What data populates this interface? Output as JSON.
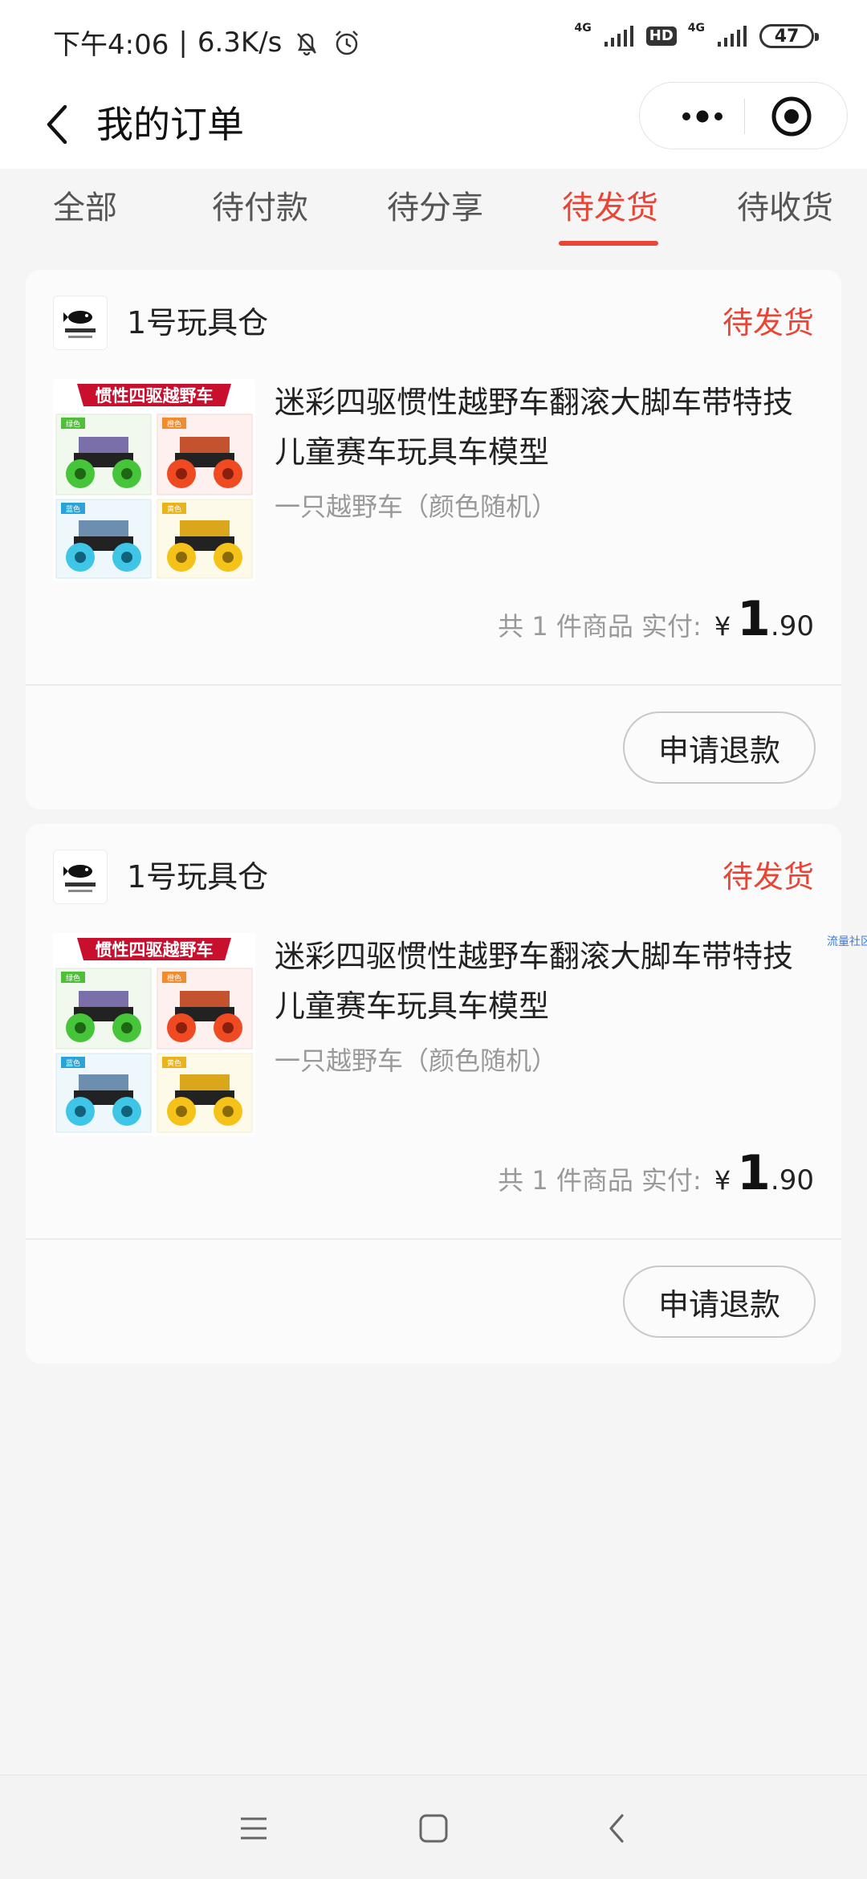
{
  "status_bar": {
    "time": "下午4:06",
    "speed": "6.3K/s",
    "network_1": "4G",
    "hd": "HD",
    "network_2": "4G",
    "battery": "47"
  },
  "nav": {
    "title": "我的订单"
  },
  "tabs": [
    {
      "label": "全部"
    },
    {
      "label": "待付款"
    },
    {
      "label": "待分享"
    },
    {
      "label": "待发货",
      "active": true
    },
    {
      "label": "待收货"
    }
  ],
  "orders": [
    {
      "shop_name": "1号玩具仓",
      "status": "待发货",
      "title": "迷彩四驱惯性越野车翻滚大脚车带特技儿童赛车玩具车模型",
      "spec": "一只越野车（颜色随机）",
      "total_label": "共 1 件商品 实付:",
      "currency": "¥",
      "price_int": "1",
      "price_dec": ".90",
      "button": "申请退款",
      "image_banner": "惯性四驱越野车",
      "image_tags": [
        "绿色",
        "橙色",
        "蓝色",
        "黄色"
      ]
    },
    {
      "shop_name": "1号玩具仓",
      "status": "待发货",
      "title": "迷彩四驱惯性越野车翻滚大脚车带特技儿童赛车玩具车模型",
      "spec": "一只越野车（颜色随机）",
      "total_label": "共 1 件商品 实付:",
      "currency": "¥",
      "price_int": "1",
      "price_dec": ".90",
      "button": "申请退款",
      "image_banner": "惯性四驱越野车",
      "image_tags": [
        "绿色",
        "橙色",
        "蓝色",
        "黄色"
      ]
    }
  ],
  "side_tag": "流量社区",
  "colors": {
    "accent": "#e94434",
    "background": "#f5f5f5",
    "card": "#fbfbfb"
  },
  "icons": {
    "back": "chevron-left-icon",
    "more": "more-dots-icon",
    "close": "target-circle-icon",
    "menu": "menu-lines-icon",
    "home": "home-square-icon",
    "back_sys": "back-chevron-icon"
  }
}
